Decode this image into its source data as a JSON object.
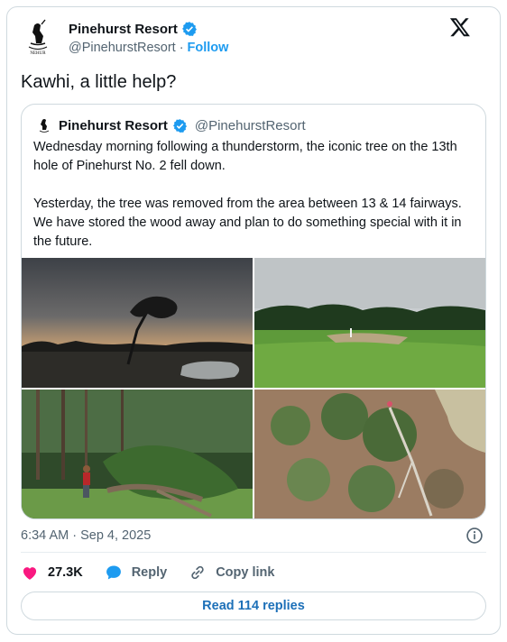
{
  "post": {
    "author_name": "Pinehurst Resort",
    "handle": "@PinehurstResort",
    "separator": "·",
    "follow_label": "Follow",
    "text": "Kawhi, a little help?",
    "timestamp": "6:34 AM · Sep 4, 2025"
  },
  "quote": {
    "author_name": "Pinehurst Resort",
    "handle": "@PinehurstResort",
    "paragraph_1": "Wednesday morning following a thunderstorm, the iconic tree on the 13th hole of Pinehurst No. 2 fell down.",
    "paragraph_2": "Yesterday, the tree was removed from the area between 13 & 14 fairways. We have stored the wood away and plan to do something special with it in the future.",
    "images": [
      {
        "name": "tree-sunrise-photo"
      },
      {
        "name": "fairway-green-photo"
      },
      {
        "name": "tree-removal-photo"
      },
      {
        "name": "fallen-tree-aerial-photo"
      }
    ]
  },
  "actions": {
    "like_count": "27.3K",
    "reply_label": "Reply",
    "copy_link_label": "Copy link"
  },
  "read_replies_label": "Read 114 replies",
  "colors": {
    "accent": "#1d9bf0",
    "like": "#f91880",
    "text_secondary": "#536471",
    "border": "#cfd9de"
  },
  "icons": [
    "verified-badge-icon",
    "x-logo-icon",
    "info-icon",
    "heart-icon",
    "reply-bubble-icon",
    "link-icon"
  ]
}
